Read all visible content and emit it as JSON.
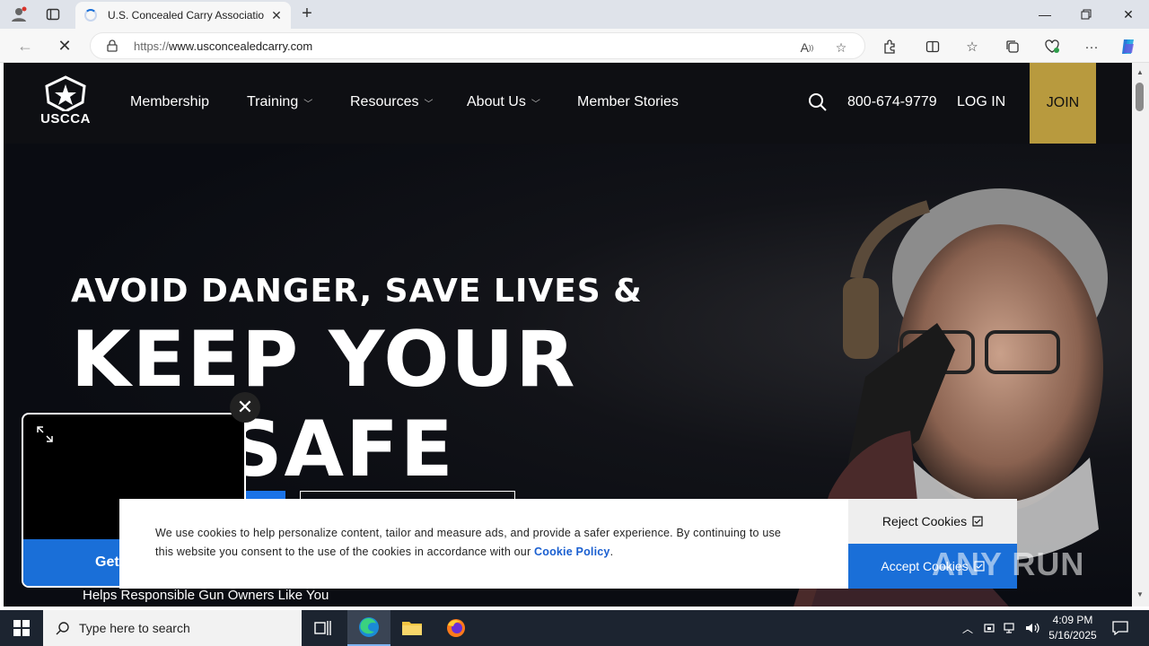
{
  "browser": {
    "tab_title": "U.S. Concealed Carry Associatio",
    "url_prefix": "https://",
    "url_domain": "www.usconcealedcarry.com"
  },
  "site": {
    "logo_text": "USCCA",
    "nav": [
      "Membership",
      "Training",
      "Resources",
      "About Us",
      "Member Stories"
    ],
    "phone": "800-674-9779",
    "login": "LOG IN",
    "join": "JOIN"
  },
  "hero": {
    "subtitle": "AVOID DANGER, SAVE LIVES &",
    "title_line1": "KEEP YOUR",
    "title_line2": "ILY SAFE",
    "tagline": "Helps Responsible Gun Owners Like You"
  },
  "video_popup": {
    "cta": "Get"
  },
  "cookie": {
    "text": "We use cookies to help personalize content, tailor and measure ads, and provide a safer experience. By continuing to use this website you consent to the use of the cookies in accordance with our",
    "link": "Cookie Policy",
    "suffix": ".",
    "reject": "Reject Cookies",
    "accept": "Accept Cookies"
  },
  "watermark": "ANY RUN",
  "taskbar": {
    "search_placeholder": "Type here to search",
    "time": "4:09 PM",
    "date": "5/16/2025"
  },
  "colors": {
    "join_bg": "#b89a3e",
    "accent_blue": "#1a6fd8",
    "nav_bg": "#0e0f13"
  }
}
